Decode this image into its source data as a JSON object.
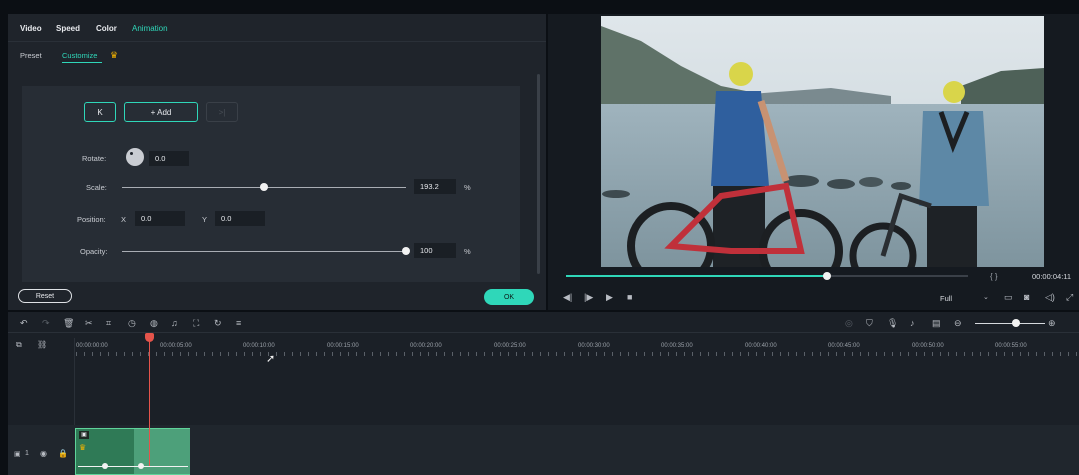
{
  "tabs": [
    {
      "label": "Video",
      "active": false
    },
    {
      "label": "Speed",
      "active": false
    },
    {
      "label": "Color",
      "active": false
    },
    {
      "label": "Animation",
      "active": true
    }
  ],
  "subtabs": [
    {
      "label": "Preset",
      "active": false
    },
    {
      "label": "Customize",
      "active": true
    }
  ],
  "keyframe": {
    "prev_label": "K",
    "add_label": "+ Add",
    "next_label": ">|"
  },
  "properties": {
    "rotate": {
      "label": "Rotate:",
      "value": "0.0"
    },
    "scale": {
      "label": "Scale:",
      "value": "193.2",
      "unit": "%",
      "level": 0.5
    },
    "position": {
      "label": "Position:",
      "x_label": "X",
      "x_value": "0.0",
      "y_label": "Y",
      "y_value": "0.0"
    },
    "opacity": {
      "label": "Opacity:",
      "value": "100",
      "unit": "%",
      "level": 1.0
    }
  },
  "buttons": {
    "reset": "Reset",
    "ok": "OK"
  },
  "player": {
    "progress": 0.65,
    "brackets": "{   }",
    "timecode": "00:00:04:11",
    "zoom_option": "Full"
  },
  "timeline": {
    "ticks": [
      "00:00:00:00",
      "00:00:05:00",
      "00:00:10:00",
      "00:00:15:00",
      "00:00:20:00",
      "00:00:25:00",
      "00:00:30:00",
      "00:00:35:00",
      "00:00:40:00",
      "00:00:45:00",
      "00:00:50:00",
      "00:00:55:00"
    ],
    "track_label": "1"
  },
  "colors": {
    "accent": "#2fd7b9",
    "playhead": "#e5544b",
    "clip": "#3d8a63"
  }
}
